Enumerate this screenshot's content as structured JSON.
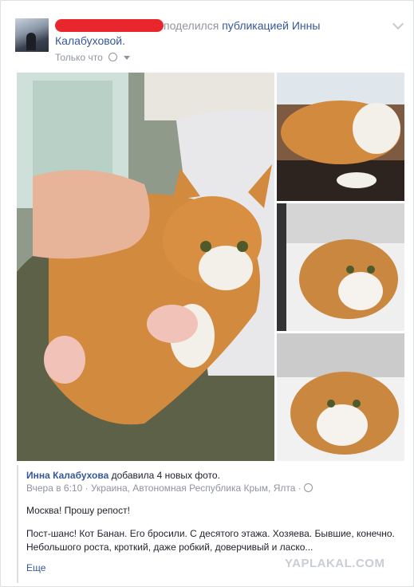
{
  "post": {
    "shared_text": "поделился",
    "shared_link": "публикацией Инны Калабуховой.",
    "privacy": "Только что"
  },
  "photos": {
    "main": "orange-white-cat-held-in-arms",
    "side": [
      "orange-cat-lying",
      "orange-cat-in-cage",
      "orange-cat-lying-close-up"
    ]
  },
  "quoted": {
    "author": "Инна Калабухова",
    "action": "добавила 4 новых фото.",
    "time": "Вчера в 6:10",
    "location": "Украина, Автономная Республика Крым, Ялта",
    "text1": "Москва! Прошу репост!",
    "text2": "Пост-шанс! Кот Банан. Его бросили. С десятого этажа. Хозяева. Бывшие, конечно. Небольшого роста, кроткий, даже робкий, доверчивый и ласко...",
    "more": "Еще"
  },
  "watermark": "YAPLAKAL.COM"
}
